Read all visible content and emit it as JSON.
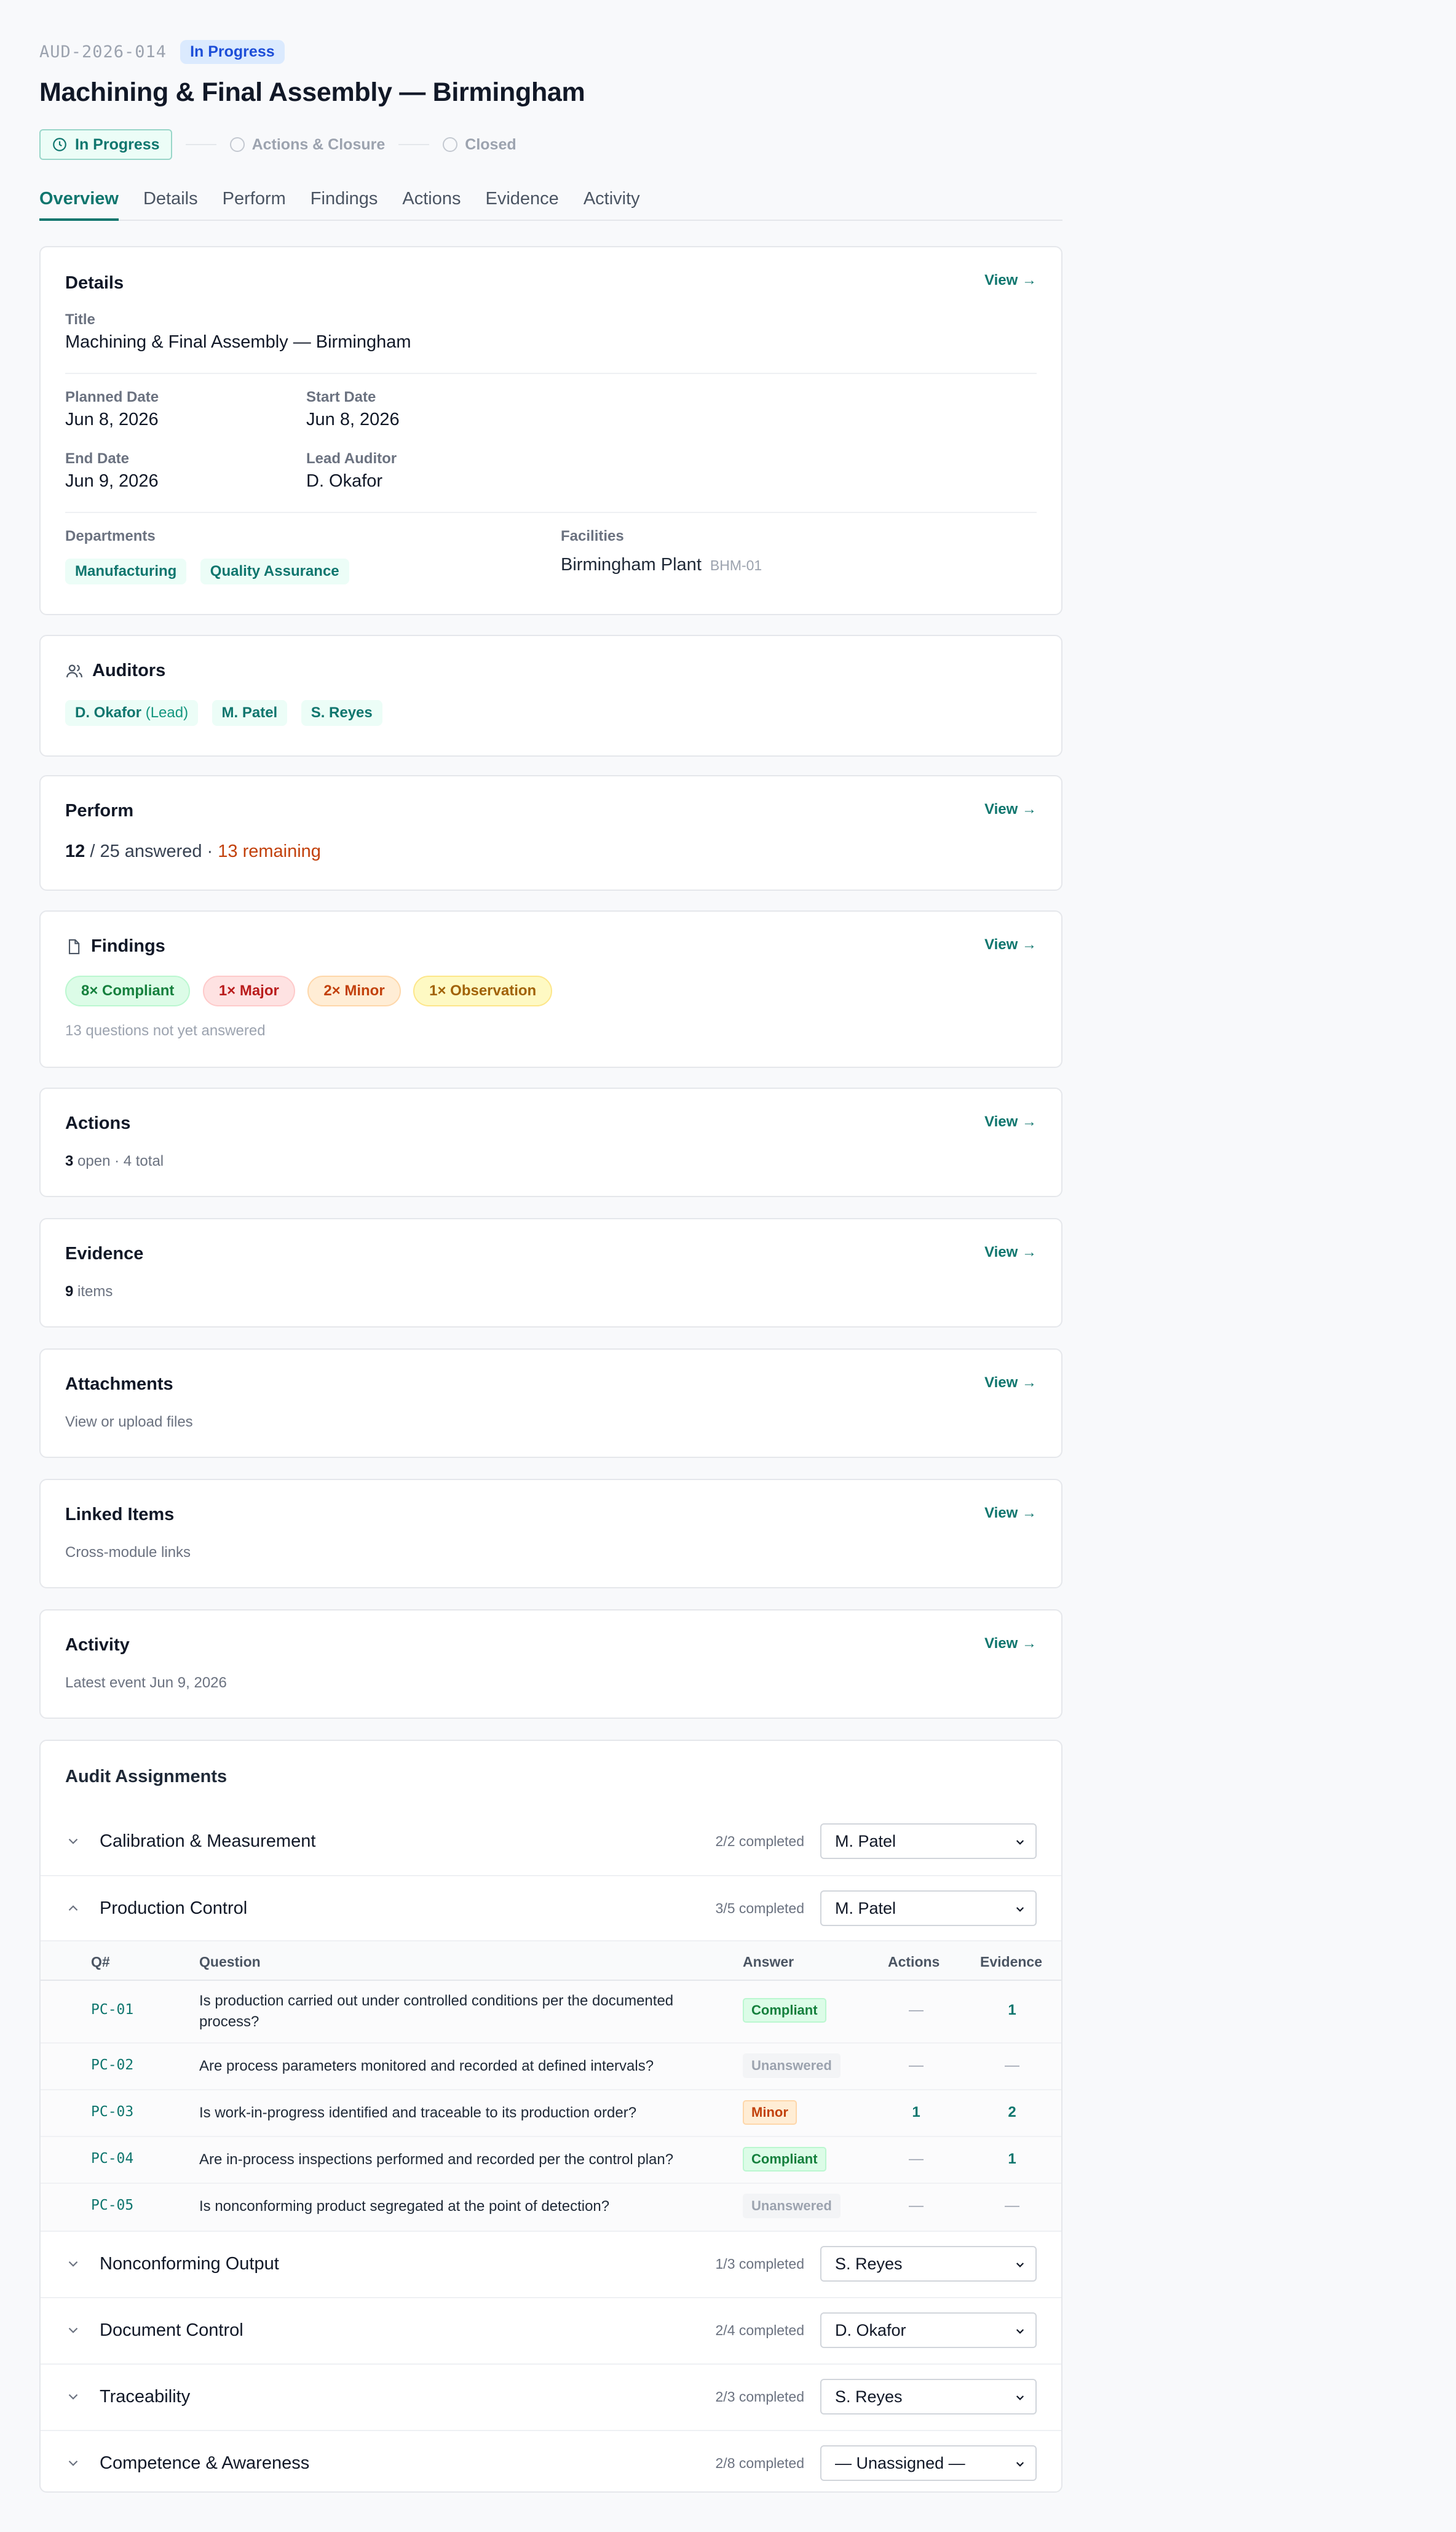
{
  "header": {
    "audit_id": "AUD-2026-014",
    "status_badge": "In Progress",
    "title": "Machining & Final Assembly — Birmingham"
  },
  "stepper": {
    "steps": [
      "In Progress",
      "Actions & Closure",
      "Closed"
    ]
  },
  "tabs": [
    "Overview",
    "Details",
    "Perform",
    "Findings",
    "Actions",
    "Evidence",
    "Activity"
  ],
  "view_label": "View →",
  "details": {
    "heading": "Details",
    "title_label": "Title",
    "title_value": "Machining & Final Assembly — Birmingham",
    "planned_label": "Planned Date",
    "planned_value": "Jun 8, 2026",
    "start_label": "Start Date",
    "start_value": "Jun 8, 2026",
    "end_label": "End Date",
    "end_value": "Jun 9, 2026",
    "lead_label": "Lead Auditor",
    "lead_value": "D. Okafor",
    "departments_label": "Departments",
    "departments": [
      "Manufacturing",
      "Quality Assurance"
    ],
    "facilities_label": "Facilities",
    "facility_name": "Birmingham Plant",
    "facility_code": "BHM-01"
  },
  "auditors": {
    "heading": "Auditors",
    "list": [
      {
        "name": "D. Okafor",
        "role": "(Lead)"
      },
      {
        "name": "M. Patel",
        "role": ""
      },
      {
        "name": "S. Reyes",
        "role": ""
      }
    ]
  },
  "perform": {
    "heading": "Perform",
    "answered": "12",
    "total_text": "/ 25 answered ·",
    "remaining_text": "13 remaining"
  },
  "findings": {
    "heading": "Findings",
    "pills": [
      {
        "label": "8× Compliant",
        "tone": "g"
      },
      {
        "label": "1× Major",
        "tone": "r"
      },
      {
        "label": "2× Minor",
        "tone": "o"
      },
      {
        "label": "1× Observation",
        "tone": "y"
      }
    ],
    "note": "13 questions not yet answered"
  },
  "actions": {
    "heading": "Actions",
    "open": "3",
    "rest": "open · 4 total"
  },
  "evidence": {
    "heading": "Evidence",
    "count": "9",
    "rest": "items"
  },
  "attachments": {
    "heading": "Attachments",
    "note": "View or upload files"
  },
  "linked": {
    "heading": "Linked Items",
    "note": "Cross-module links"
  },
  "activity": {
    "heading": "Activity",
    "note": "Latest event Jun 9, 2026"
  },
  "assignments": {
    "heading": "Audit Assignments",
    "columns": [
      "Q#",
      "Question",
      "Answer",
      "Actions",
      "Evidence"
    ],
    "groups": [
      {
        "name": "Calibration & Measurement",
        "completed": "2/2 completed",
        "assignee": "M. Patel",
        "expanded": false
      },
      {
        "name": "Production Control",
        "completed": "3/5 completed",
        "assignee": "M. Patel",
        "expanded": true
      },
      {
        "name": "Nonconforming Output",
        "completed": "1/3 completed",
        "assignee": "S. Reyes",
        "expanded": false
      },
      {
        "name": "Document Control",
        "completed": "2/4 completed",
        "assignee": "D. Okafor",
        "expanded": false
      },
      {
        "name": "Traceability",
        "completed": "2/3 completed",
        "assignee": "S. Reyes",
        "expanded": false
      },
      {
        "name": "Competence & Awareness",
        "completed": "2/8 completed",
        "assignee": "— Unassigned —",
        "expanded": false
      }
    ],
    "questions": [
      {
        "id": "PC-01",
        "text": "Is production carried out under controlled conditions per the documented process?",
        "answer": "Compliant",
        "tone": "g",
        "actions": "—",
        "evidence": "1"
      },
      {
        "id": "PC-02",
        "text": "Are process parameters monitored and recorded at defined intervals?",
        "answer": "Unanswered",
        "tone": "u",
        "actions": "—",
        "evidence": "—"
      },
      {
        "id": "PC-03",
        "text": "Is work-in-progress identified and traceable to its production order?",
        "answer": "Minor",
        "tone": "o",
        "actions": "1",
        "evidence": "2"
      },
      {
        "id": "PC-04",
        "text": "Are in-process inspections performed and recorded per the control plan?",
        "answer": "Compliant",
        "tone": "g",
        "actions": "—",
        "evidence": "1"
      },
      {
        "id": "PC-05",
        "text": "Is nonconforming product segregated at the point of detection?",
        "answer": "Unanswered",
        "tone": "u",
        "actions": "—",
        "evidence": "—"
      }
    ]
  }
}
